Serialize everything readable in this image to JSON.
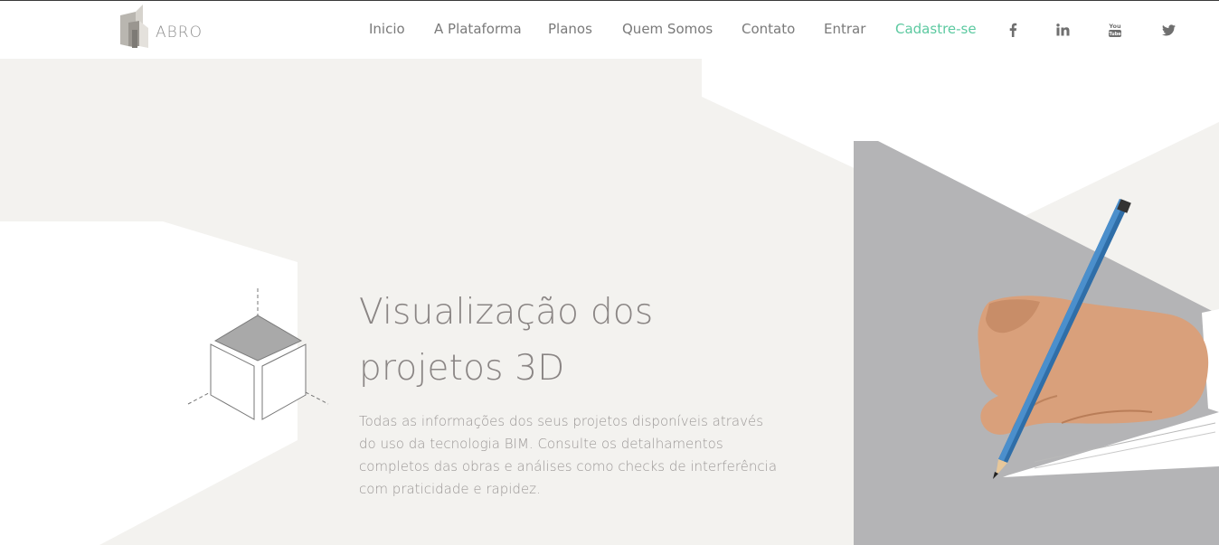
{
  "brand": {
    "logo_text": "ABRO"
  },
  "nav": {
    "items": [
      {
        "label": "Inicio"
      },
      {
        "label": "A Plataforma"
      },
      {
        "label": "Planos"
      },
      {
        "label": "Quem Somos"
      },
      {
        "label": "Contato"
      },
      {
        "label": "Entrar"
      },
      {
        "label": "Cadastre-se"
      }
    ],
    "social": [
      {
        "icon": "facebook-icon",
        "glyph": "f"
      },
      {
        "icon": "linkedin-icon",
        "glyph": "in"
      },
      {
        "icon": "youtube-icon",
        "glyph": "You Tube"
      },
      {
        "icon": "twitter-icon",
        "glyph": "bird"
      }
    ]
  },
  "hero": {
    "title_line1": "Visualização dos",
    "title_line2": "projetos 3D",
    "description": "Todas as informações dos seus projetos disponíveis através do uso da tecnologia BIM. Consulte os detalhamentos completos das obras e análises como checks de interferência com praticidade e rapidez."
  },
  "colors": {
    "accent": "#5cc9a0",
    "nav_text": "#7a7a7a",
    "hero_bg": "#f3f2ef",
    "panel_gray": "#b4b4b6",
    "title_text": "#8a8584"
  }
}
